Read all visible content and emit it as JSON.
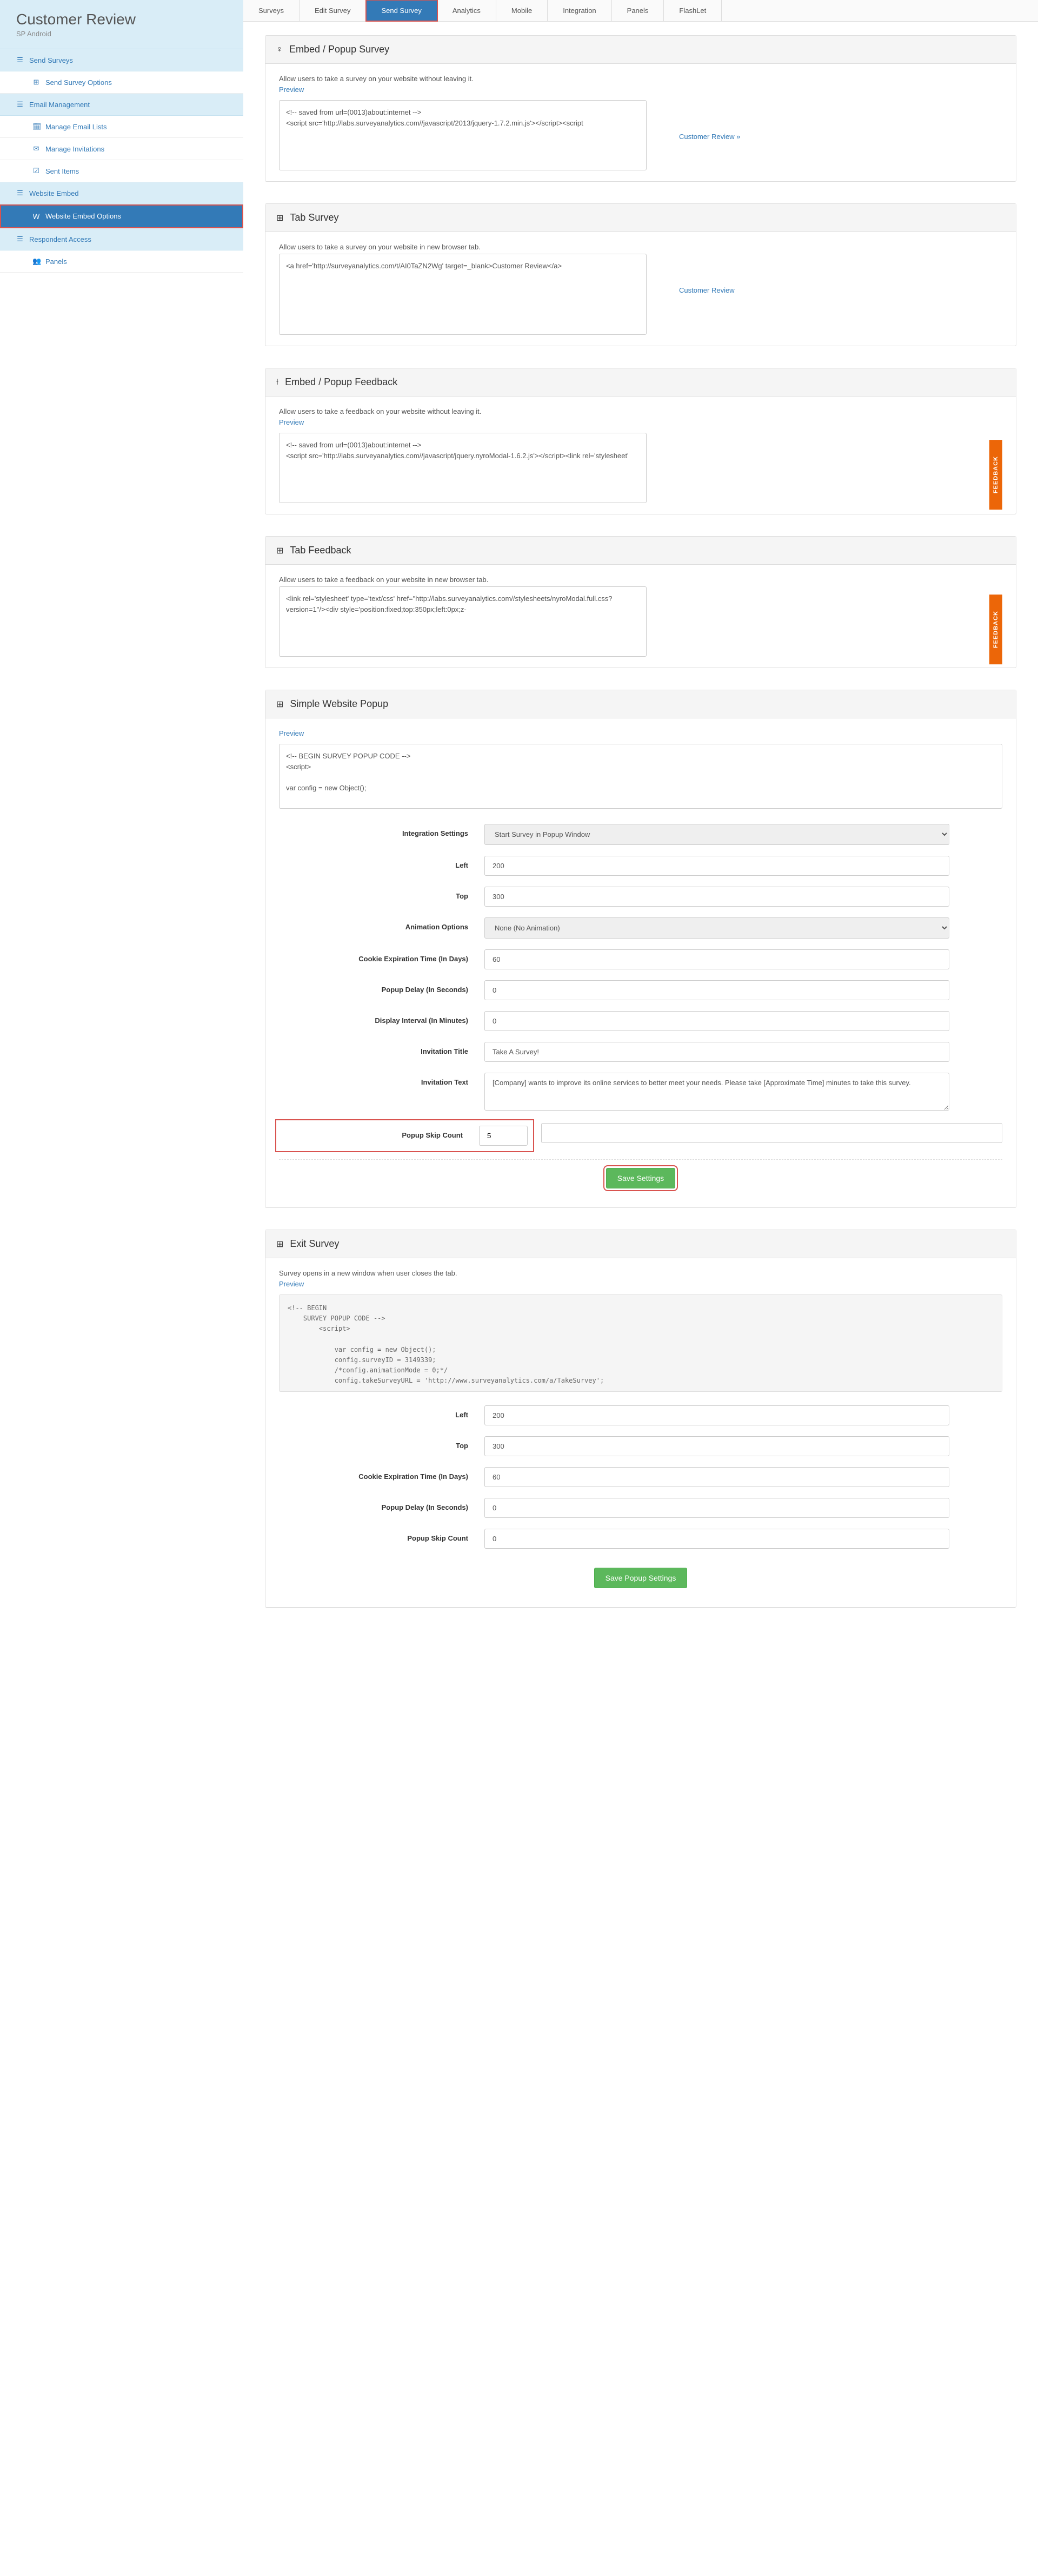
{
  "sidebar": {
    "title": "Customer Review",
    "subtitle": "SP Android",
    "sections": [
      {
        "label": "Send Surveys",
        "icon": "☰"
      },
      {
        "label": "Send Survey Options",
        "icon": "⊞",
        "type": "item"
      },
      {
        "label": "Email Management",
        "icon": "☰"
      },
      {
        "label": "Manage Email Lists",
        "icon": "🗓",
        "type": "item"
      },
      {
        "label": "Manage Invitations",
        "icon": "✉",
        "type": "item"
      },
      {
        "label": "Sent Items",
        "icon": "☑",
        "type": "item"
      },
      {
        "label": "Website Embed",
        "icon": "☰"
      },
      {
        "label": "Website Embed Options",
        "icon": "Ｗ",
        "type": "item",
        "active": true
      },
      {
        "label": "Respondent Access",
        "icon": "☰"
      },
      {
        "label": "Panels",
        "icon": "👥",
        "type": "item"
      }
    ]
  },
  "tabs": [
    "Surveys",
    "Edit Survey",
    "Send Survey",
    "Analytics",
    "Mobile",
    "Integration",
    "Panels",
    "FlashLet"
  ],
  "active_tab": "Send Survey",
  "panels": {
    "embed_popup": {
      "title": "Embed / Popup Survey",
      "desc": "Allow users to take a survey on your website without leaving it.",
      "preview": "Preview",
      "code": "<!-- saved from url=(0013)about:internet -->\n<script src='http://labs.surveyanalytics.com//javascript/2013/jquery-1.7.2.min.js'></script><script",
      "side_link": "Customer Review »"
    },
    "tab_survey": {
      "title": "Tab Survey",
      "desc": "Allow users to take a survey on your website in new browser tab.",
      "code": "<a href='http://surveyanalytics.com/t/AI0TaZN2Wg' target=_blank>Customer Review</a>",
      "side_link": "Customer Review"
    },
    "embed_feedback": {
      "title": "Embed / Popup Feedback",
      "desc": "Allow users to take a feedback on your website without leaving it.",
      "preview": "Preview",
      "code": "<!-- saved from url=(0013)about:internet -->\n<script src='http://labs.surveyanalytics.com//javascript/jquery.nyroModal-1.6.2.js'></script><link rel='stylesheet'",
      "feedback_label": "FEEDBACK"
    },
    "tab_feedback": {
      "title": "Tab Feedback",
      "desc": "Allow users to take a feedback on your website in new browser tab.",
      "code": "<link rel='stylesheet' type='text/css' href=\"http://labs.surveyanalytics.com//stylesheets/nyroModal.full.css?version=1\"/><div style='position:fixed;top:350px;left:0px;z-",
      "feedback_label": "FEEDBACK"
    },
    "simple_popup": {
      "title": "Simple Website Popup",
      "preview": "Preview",
      "code": "<!-- BEGIN SURVEY POPUP CODE -->\n<script>\n\nvar config = new Object();",
      "fields": {
        "integration_settings": {
          "label": "Integration Settings",
          "value": "Start Survey in Popup Window"
        },
        "left": {
          "label": "Left",
          "value": "200"
        },
        "top": {
          "label": "Top",
          "value": "300"
        },
        "animation": {
          "label": "Animation Options",
          "value": "None (No Animation)"
        },
        "cookie": {
          "label": "Cookie Expiration Time (In Days)",
          "value": "60"
        },
        "delay": {
          "label": "Popup Delay (In Seconds)",
          "value": "0"
        },
        "interval": {
          "label": "Display Interval (In Minutes)",
          "value": "0"
        },
        "inv_title": {
          "label": "Invitation Title",
          "value": "Take A Survey!"
        },
        "inv_text": {
          "label": "Invitation Text",
          "value": "[Company] wants to improve its online services to better meet your needs. Please take [Approximate Time] minutes to take this survey."
        },
        "skip_count": {
          "label": "Popup Skip Count",
          "value": "5"
        }
      },
      "save_btn": "Save Settings"
    },
    "exit_survey": {
      "title": "Exit Survey",
      "desc": "Survey opens in a new window when user closes the tab.",
      "preview": "Preview",
      "code": "<!-- BEGIN\n    SURVEY POPUP CODE -->\n        <script>\n\n            var config = new Object();\n            config.surveyID = 3149339;\n            /*config.animationMode = 0;*/\n            config.takeSurveyURL = 'http://www.surveyanalytics.com/a/TakeSurvey';",
      "fields": {
        "left": {
          "label": "Left",
          "value": "200"
        },
        "top": {
          "label": "Top",
          "value": "300"
        },
        "cookie": {
          "label": "Cookie Expiration Time (In Days)",
          "value": "60"
        },
        "delay": {
          "label": "Popup Delay (In Seconds)",
          "value": "0"
        },
        "skip_count": {
          "label": "Popup Skip Count",
          "value": "0"
        }
      },
      "save_btn": "Save Popup Settings"
    }
  }
}
